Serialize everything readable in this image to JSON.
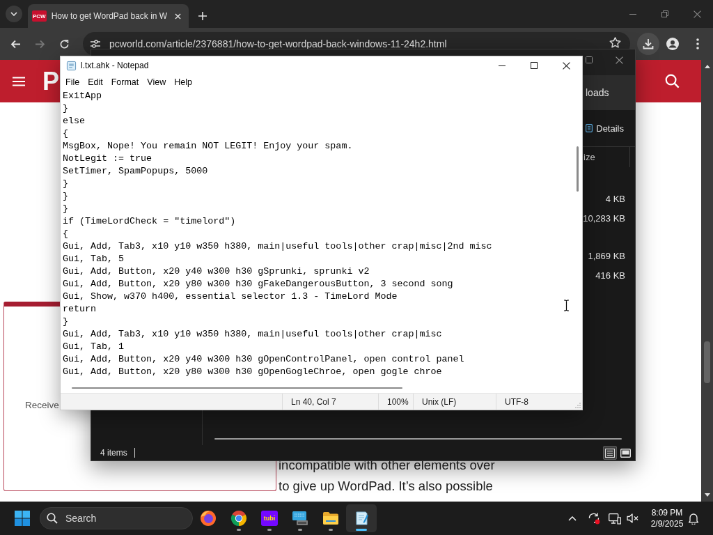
{
  "browser": {
    "tab": {
      "favicon": "PCW",
      "title": "How to get WordPad back in W",
      "selected": true
    },
    "nav_buttons": [
      {
        "kind": "back",
        "disabled": false
      },
      {
        "kind": "forward",
        "disabled": true
      },
      {
        "kind": "reload",
        "disabled": false
      }
    ],
    "url": "pcworld.com/article/2376881/how-to-get-wordpad-back-windows-11-24h2.html",
    "bookmarked": false,
    "downloads_highlighted": true,
    "page": {
      "logo": "P",
      "card": {
        "text": "Receive"
      },
      "article_lines": [
        "incompatible with other elements over",
        "to give up WordPad. It’s also possible"
      ]
    }
  },
  "explorer": {
    "location": "loads",
    "view_button": "Details",
    "column_heading": "ize",
    "rows": [
      {
        "kind": "file",
        "size": "4 KB"
      },
      {
        "kind": "file",
        "size": "10,283 KB"
      },
      {
        "kind": "group_header"
      },
      {
        "kind": "file",
        "size": "1,869 KB"
      },
      {
        "kind": "file",
        "size": "416 KB"
      }
    ],
    "status": "4 items",
    "view_modes": [
      {
        "kind": "details",
        "selected": true
      },
      {
        "kind": "preview",
        "selected": false
      }
    ]
  },
  "notepad": {
    "title": "l.txt.ahk - Notepad",
    "menu": [
      "File",
      "Edit",
      "Format",
      "View",
      "Help"
    ],
    "lines": [
      "ExitApp",
      "}",
      "else",
      "{",
      "MsgBox, Nope! You remain NOT LEGIT! Enjoy your spam.",
      "NotLegit := true",
      "SetTimer, SpamPopups, 5000",
      "}",
      "}",
      "}",
      "if (TimeLordCheck = \"timelord\")",
      "{",
      "Gui, Add, Tab3, x10 y10 w350 h380, main|useful tools|other crap|misc|2nd misc",
      "Gui, Tab, 5",
      "Gui, Add, Button, x20 y40 w300 h30 gSprunki, sprunki v2",
      "Gui, Add, Button, x20 y80 w300 h30 gFakeDangerousButton, 3 second song",
      "Gui, Show, w370 h400, essential selector 1.3 - TimeLord Mode",
      "return",
      "}",
      "Gui, Add, Tab3, x10 y10 w350 h380, main|useful tools|other crap|misc",
      "Gui, Tab, 1",
      "Gui, Add, Button, x20 y40 w300 h30 gOpenControlPanel, open control panel",
      "Gui, Add, Button, x20 y80 w300 h30 gOpenGogleChroe, open gogle chroe"
    ],
    "status": {
      "position": "Ln 40, Col 7",
      "zoom": "100%",
      "line_ending": "Unix (LF)",
      "encoding": "UTF-8"
    }
  },
  "taskbar": {
    "search": {
      "placeholder": "Search"
    },
    "apps": [
      {
        "kind": "firefox",
        "running": false,
        "active": false
      },
      {
        "kind": "chrome",
        "running": true,
        "active": false
      },
      {
        "kind": "tubi",
        "label": "tubi",
        "running": true,
        "active": false
      },
      {
        "kind": "remote_desktop",
        "running": true,
        "active": false
      },
      {
        "kind": "file_explorer",
        "running": true,
        "active": false
      },
      {
        "kind": "notepad",
        "running": true,
        "active": true
      }
    ],
    "clock": {
      "time": "8:09 PM",
      "date": "2/9/2025"
    }
  }
}
